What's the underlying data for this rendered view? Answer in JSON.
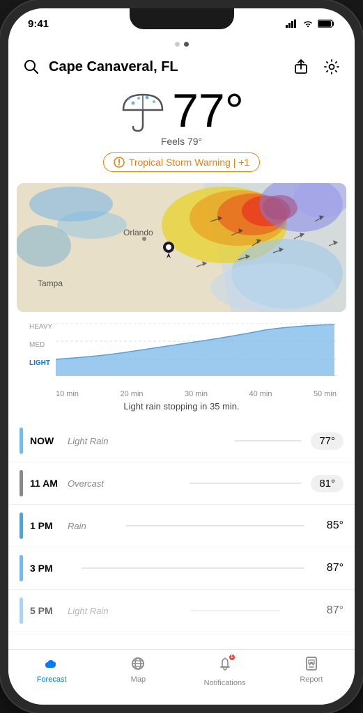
{
  "status_bar": {
    "time": "9:41",
    "location_arrow": true
  },
  "pagination": {
    "dots": [
      false,
      true
    ]
  },
  "header": {
    "location": "Cape Canaveral, FL",
    "search_icon": "search",
    "share_icon": "share",
    "settings_icon": "gear"
  },
  "weather": {
    "temperature": "77°",
    "feels_like": "Feels 79°",
    "icon_label": "umbrella-rain",
    "warning": "Tropical Storm Warning | +1"
  },
  "rain_chart": {
    "labels_y": [
      "HEAVY",
      "MED",
      "LIGHT"
    ],
    "labels_x": [
      "10 min",
      "20 min",
      "30 min",
      "40 min",
      "50 min"
    ],
    "summary": "Light rain stopping in 35 min."
  },
  "hourly_forecast": [
    {
      "time": "NOW",
      "condition": "Light Rain",
      "temp": "77°",
      "color": "#7ab8e8",
      "has_bubble": true
    },
    {
      "time": "11 AM",
      "condition": "Overcast",
      "temp": "81°",
      "color": "#888888",
      "has_bubble": true
    },
    {
      "time": "1 PM",
      "condition": "Rain",
      "temp": "85°",
      "color": "#5a9fd4",
      "has_bubble": false
    },
    {
      "time": "3 PM",
      "condition": "",
      "temp": "87°",
      "color": "#7ab8e8",
      "has_bubble": false
    },
    {
      "time": "5 PM",
      "condition": "Light Rain",
      "temp": "87°",
      "color": "#7ab8e8",
      "has_bubble": false
    }
  ],
  "tab_bar": {
    "items": [
      {
        "label": "Forecast",
        "icon": "forecast",
        "active": true
      },
      {
        "label": "Map",
        "icon": "map",
        "active": false
      },
      {
        "label": "Notifications",
        "icon": "notifications",
        "active": false
      },
      {
        "label": "Report",
        "icon": "report",
        "active": false
      }
    ]
  }
}
